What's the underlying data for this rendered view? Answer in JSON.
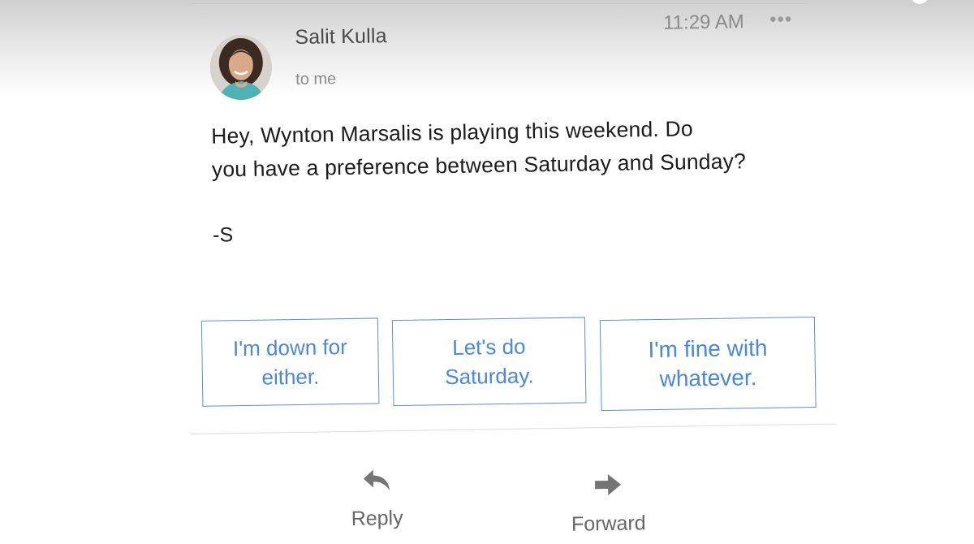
{
  "email": {
    "sender_name": "Salit Kulla",
    "recipient": "to me",
    "time": "11:29 AM",
    "more_icon": "more-horiz-icon",
    "body_line_1": "Hey, Wynton Marsalis is playing this weekend. Do",
    "body_line_2": "you have a preference between Saturday and Sunday?",
    "signature": "-S"
  },
  "smart_replies": [
    {
      "line1": "I'm down for",
      "line2": "either."
    },
    {
      "line1": "Let's do",
      "line2": "Saturday."
    },
    {
      "line1": "I'm fine with",
      "line2": "whatever."
    }
  ],
  "actions": {
    "reply": {
      "label": "Reply",
      "icon": "reply-icon"
    },
    "forward": {
      "label": "Forward",
      "icon": "forward-icon"
    }
  },
  "colors": {
    "accent_blue": "#4a88d8",
    "chip_border": "#5b8fd6",
    "text_primary": "#1c1c1c",
    "text_secondary": "#8a8a8a"
  }
}
